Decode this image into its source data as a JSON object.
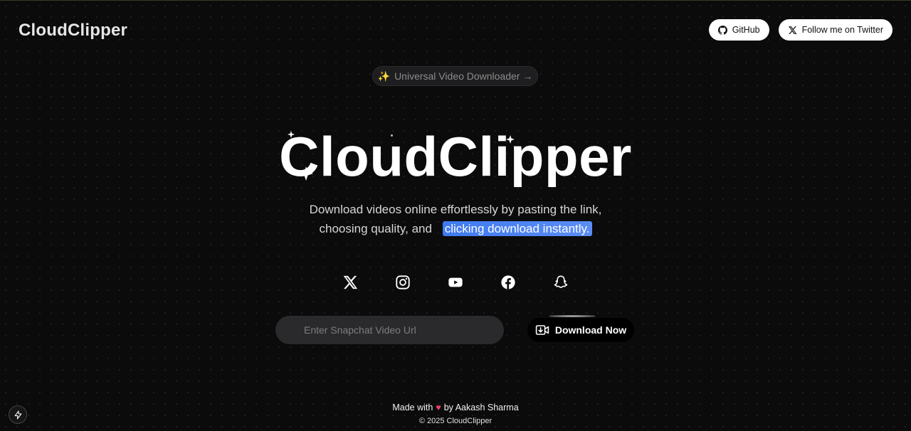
{
  "header": {
    "brand": "CloudClipper",
    "github_label": "GitHub",
    "twitter_label": "Follow me on Twitter"
  },
  "announcement": {
    "icon": "✨",
    "text": "Universal Video Downloader →"
  },
  "hero": {
    "title": "CloudClipper",
    "subtitle_line1": "Download videos online effortlessly by pasting the link,",
    "subtitle_line2": "choosing quality, and",
    "subtitle_highlight": "clicking download instantly."
  },
  "platforms": [
    "x-icon",
    "instagram-icon",
    "youtube-icon",
    "facebook-icon",
    "snapchat-icon"
  ],
  "form": {
    "placeholder": "Enter Snapchat Video Url",
    "button_label": "Download Now"
  },
  "footer": {
    "made_with": "Made with",
    "heart": "♥",
    "by": "by Aakash Sharma",
    "copyright": "© 2025 CloudClipper"
  },
  "colors": {
    "background": "#0b0b0c",
    "highlight": "#3f7af0",
    "heart": "#f0436a",
    "spark": "#e8b547"
  }
}
